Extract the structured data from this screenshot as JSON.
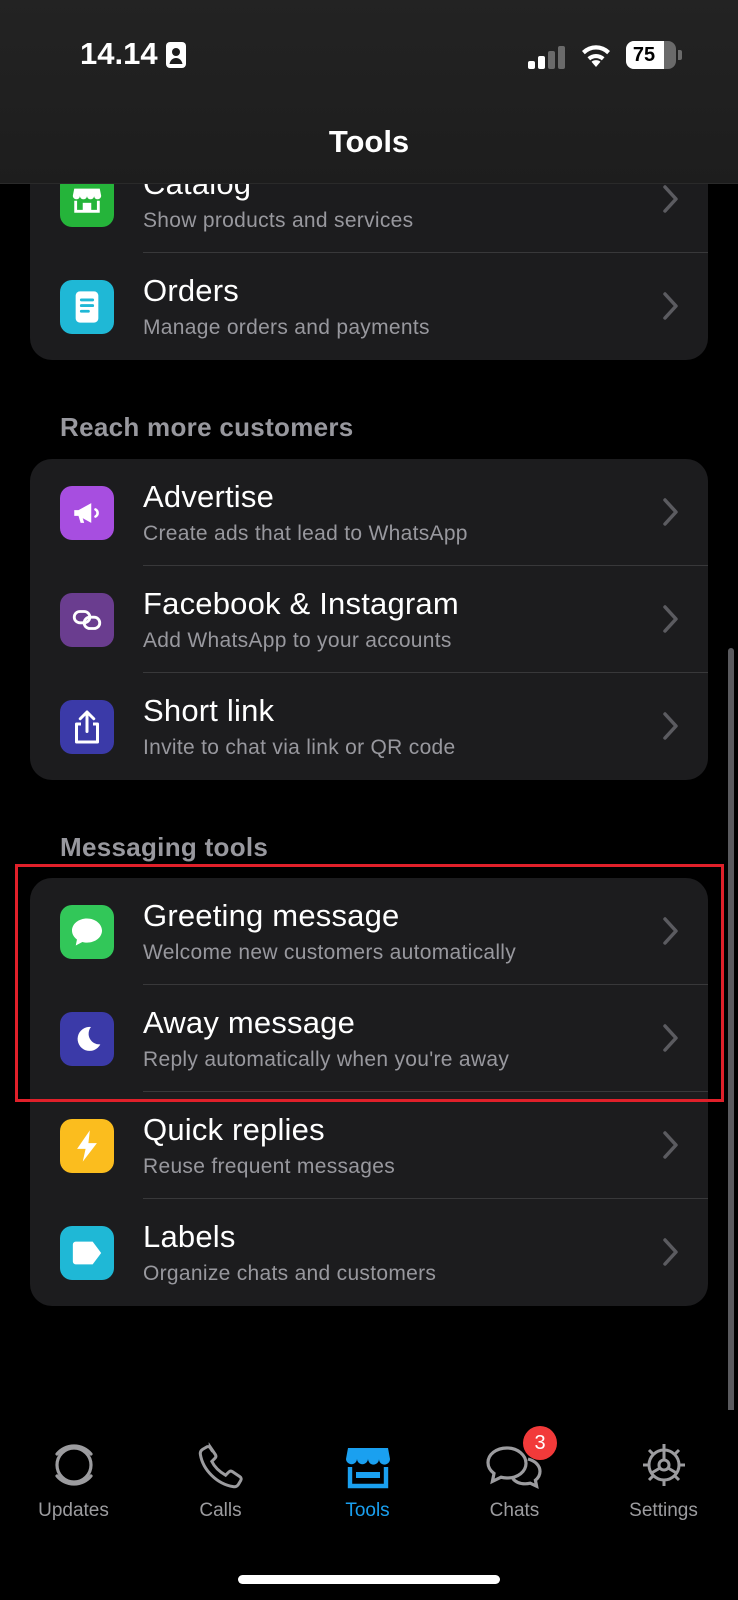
{
  "status_bar": {
    "time": "14.14",
    "battery": "75"
  },
  "nav": {
    "title": "Tools"
  },
  "groups": {
    "catalog_group": {
      "items": [
        {
          "title": "Catalog",
          "subtitle": "Show products and services",
          "icon": "storefront-icon",
          "color": "#25b43a"
        },
        {
          "title": "Orders",
          "subtitle": "Manage orders and payments",
          "icon": "document-icon",
          "color": "#1fb8d6"
        }
      ]
    },
    "reach": {
      "header": "Reach more customers",
      "items": [
        {
          "title": "Advertise",
          "subtitle": "Create ads that lead to WhatsApp",
          "icon": "megaphone-icon",
          "color": "#a74ee0"
        },
        {
          "title": "Facebook & Instagram",
          "subtitle": "Add WhatsApp to your accounts",
          "icon": "link-rings-icon",
          "color": "#6a3d8f"
        },
        {
          "title": "Short link",
          "subtitle": "Invite to chat via link or QR code",
          "icon": "share-icon",
          "color": "#3b3aa8"
        }
      ]
    },
    "messaging": {
      "header": "Messaging tools",
      "items": [
        {
          "title": "Greeting message",
          "subtitle": "Welcome new customers automatically",
          "icon": "chat-bubble-icon",
          "color": "#32c759"
        },
        {
          "title": "Away message",
          "subtitle": "Reply automatically when you're away",
          "icon": "moon-icon",
          "color": "#3b3aa8"
        },
        {
          "title": "Quick replies",
          "subtitle": "Reuse frequent messages",
          "icon": "lightning-icon",
          "color": "#fbbd1e"
        },
        {
          "title": "Labels",
          "subtitle": "Organize chats and customers",
          "icon": "tag-icon",
          "color": "#1fb8d6"
        }
      ]
    }
  },
  "tabs": [
    {
      "label": "Updates",
      "icon": "updates-icon",
      "active": false
    },
    {
      "label": "Calls",
      "icon": "phone-icon",
      "active": false
    },
    {
      "label": "Tools",
      "icon": "store-icon",
      "active": true
    },
    {
      "label": "Chats",
      "icon": "chats-icon",
      "active": false,
      "badge": "3"
    },
    {
      "label": "Settings",
      "icon": "gear-icon",
      "active": false
    }
  ],
  "colors": {
    "accent": "#1aa0f0",
    "highlight": "#e0202a",
    "badge": "#f23a3a"
  }
}
